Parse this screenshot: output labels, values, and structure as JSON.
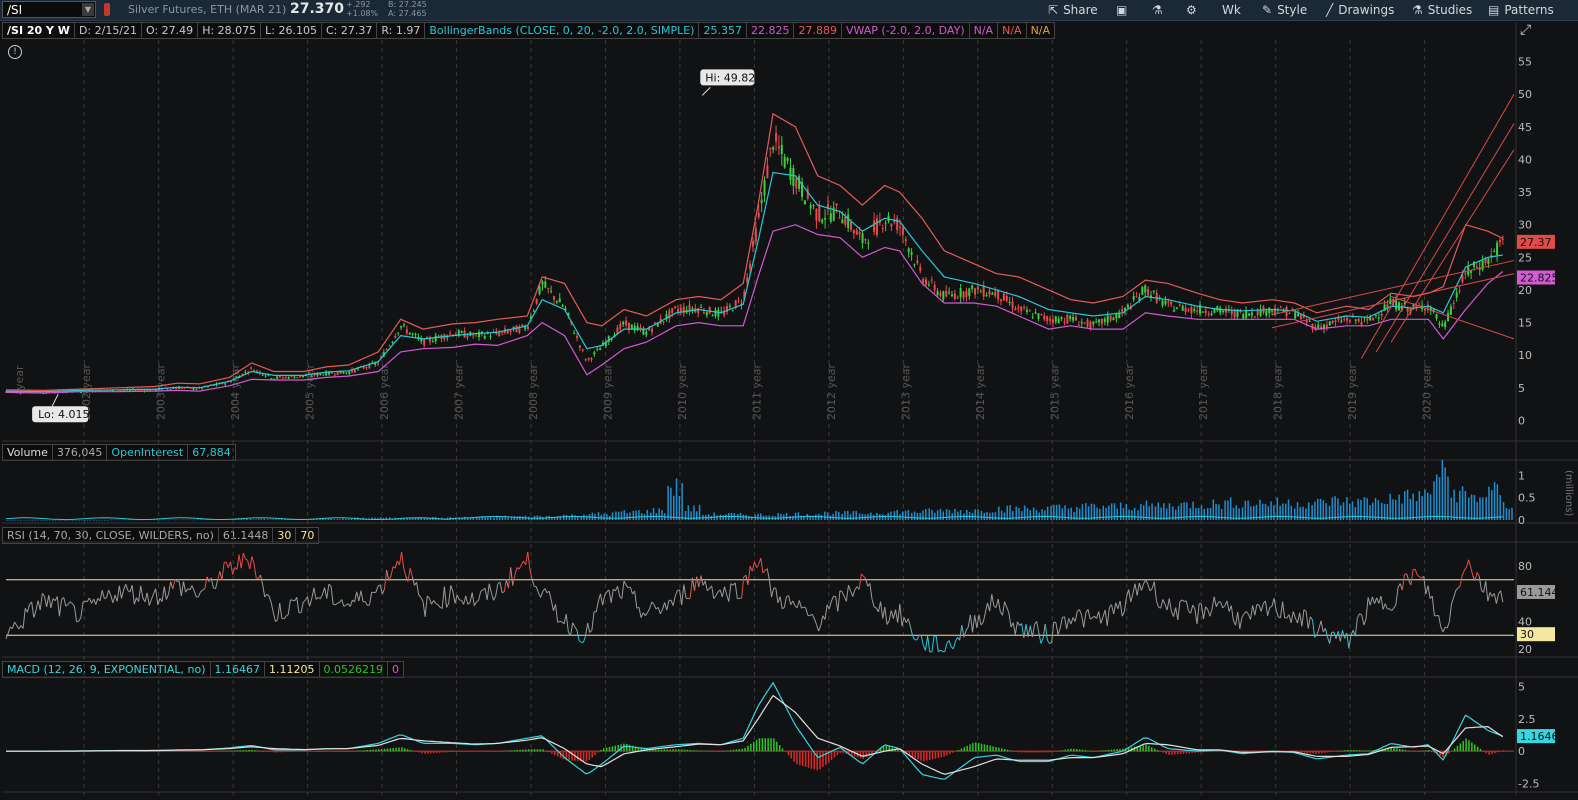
{
  "toolbar": {
    "symbol": "/SI",
    "description": "Silver Futures, ETH (MAR 21)",
    "last": "27.370",
    "change": "+.292",
    "change_pct": "+1.08%",
    "bid": "B: 27.245",
    "ask": "A: 27.465",
    "share_label": "Share",
    "aggregation_label": "Wk",
    "style_label": "Style",
    "drawings_label": "Drawings",
    "studies_label": "Studies",
    "patterns_label": "Patterns"
  },
  "price_header": {
    "tf": "/SI 20 Y W",
    "date": "D: 2/15/21",
    "open": "O: 27.49",
    "high": "H: 28.075",
    "low": "L: 26.105",
    "close": "C: 27.37",
    "range": "R: 1.97",
    "bb_label": "BollingerBands (CLOSE, 0, 20, -2.0, 2.0, SIMPLE)",
    "bb_mid": "25.357",
    "bb_low": "22.825",
    "bb_up": "27.889",
    "vwap_label": "VWAP (-2.0, 2.0, DAY)",
    "vwap_1": "N/A",
    "vwap_2": "N/A",
    "vwap_3": "N/A"
  },
  "volume_header": {
    "label": "Volume",
    "value": "376,045",
    "oi_label": "OpenInterest",
    "oi_value": "67,884"
  },
  "rsi_header": {
    "label": "RSI (14, 70, 30, CLOSE, WILDERS, no)",
    "value": "61.1448",
    "os": "30",
    "ob": "70"
  },
  "macd_header": {
    "label": "MACD (12, 26, 9, EXPONENTIAL, no)",
    "value": "1.16467",
    "avg": "1.11205",
    "diff": "0.0526219",
    "zero": "0"
  },
  "annotations": {
    "hi": "Hi: 49.82",
    "lo": "Lo: 4.015",
    "last_price": "27.37",
    "bb_lower_tag": "22.825",
    "rsi_tag": "61.1448",
    "rsi_os_tag": "30",
    "macd_tag": "1.16467"
  },
  "volume_unit": "(millions)",
  "colors": {
    "bg": "#111214",
    "up": "#3ecf3e",
    "down": "#e84a4a",
    "bb_upper": "#e65a5a",
    "bb_mid": "#28c8d8",
    "bb_lower": "#d25ad2",
    "volume": "#1f8fcf",
    "rsi": "#9a9a9a",
    "macd": "#38d6e0",
    "macd_avg": "#e0e0e0",
    "hist_up": "#28c828",
    "hist_down": "#e02828",
    "band_line": "#f5e6a0"
  },
  "chart_data": [
    {
      "type": "line",
      "title": "/SI 20 Y W",
      "x_label_format": "year",
      "x_years": [
        "2002 year",
        "2003 year",
        "2004 year",
        "2005 year",
        "2006 year",
        "2007 year",
        "2008 year",
        "2009 year",
        "2010 year",
        "2011 year",
        "2012 year",
        "2013 year",
        "2014 year",
        "2015 year",
        "2016 year",
        "2017 year",
        "2018 year",
        "2019 year",
        "2020 year"
      ],
      "first_tick_label": "year",
      "ylim": [
        0,
        55
      ],
      "y_ticks": [
        0,
        5,
        10,
        15,
        20,
        25,
        30,
        35,
        40,
        45,
        50,
        55
      ],
      "series": [
        {
          "name": "close",
          "x": [
            2001.0,
            2001.5,
            2002.0,
            2002.5,
            2003.0,
            2003.3,
            2003.6,
            2004.0,
            2004.3,
            2004.6,
            2005.0,
            2005.3,
            2005.6,
            2006.0,
            2006.3,
            2006.6,
            2007.0,
            2007.3,
            2007.6,
            2008.0,
            2008.2,
            2008.5,
            2008.8,
            2009.0,
            2009.3,
            2009.6,
            2010.0,
            2010.3,
            2010.6,
            2010.9,
            2011.1,
            2011.3,
            2011.6,
            2011.9,
            2012.2,
            2012.5,
            2012.8,
            2013.0,
            2013.3,
            2013.6,
            2014.0,
            2014.3,
            2014.6,
            2015.0,
            2015.3,
            2015.6,
            2016.0,
            2016.3,
            2016.6,
            2017.0,
            2017.3,
            2017.6,
            2018.0,
            2018.3,
            2018.6,
            2019.0,
            2019.3,
            2019.6,
            2019.9,
            2020.1,
            2020.3,
            2020.6,
            2020.9,
            2021.1
          ],
          "values": [
            4.4,
            4.3,
            4.5,
            4.6,
            4.7,
            5.0,
            4.9,
            5.9,
            7.9,
            6.5,
            6.8,
            7.2,
            7.4,
            8.8,
            14.5,
            12.0,
            13.4,
            13.0,
            13.3,
            14.3,
            20.9,
            17.3,
            9.0,
            11.3,
            14.8,
            13.5,
            17.0,
            17.2,
            16.2,
            18.6,
            30.5,
            43.0,
            37.0,
            31.5,
            32.0,
            27.5,
            31.0,
            30.0,
            22.0,
            19.0,
            20.0,
            19.5,
            17.0,
            15.5,
            15.6,
            14.5,
            16.5,
            20.2,
            17.5,
            17.0,
            16.8,
            16.3,
            17.0,
            16.5,
            14.2,
            15.5,
            15.2,
            18.0,
            17.0,
            17.8,
            14.0,
            22.5,
            24.5,
            27.37
          ]
        },
        {
          "name": "bb_upper",
          "values": [
            4.7,
            4.6,
            4.8,
            5.0,
            5.2,
            5.7,
            5.6,
            6.6,
            8.8,
            7.5,
            7.5,
            8.2,
            8.5,
            10.5,
            15.5,
            14.0,
            14.8,
            15.0,
            15.5,
            16.0,
            22.0,
            21.0,
            15.0,
            14.5,
            17.0,
            16.0,
            18.5,
            19.0,
            18.5,
            21.0,
            33.0,
            47.0,
            45.0,
            37.5,
            36.0,
            33.0,
            36.0,
            35.0,
            31.0,
            26.0,
            24.0,
            22.5,
            22.0,
            20.0,
            18.5,
            18.0,
            19.0,
            21.5,
            21.0,
            19.5,
            18.5,
            18.0,
            18.5,
            18.0,
            16.5,
            17.5,
            17.0,
            19.5,
            19.0,
            19.5,
            20.5,
            30.0,
            29.0,
            27.9
          ]
        },
        {
          "name": "bb_mid",
          "values": [
            4.5,
            4.4,
            4.6,
            4.7,
            4.8,
            5.1,
            5.0,
            6.0,
            7.5,
            6.9,
            6.9,
            7.4,
            7.6,
            9.0,
            13.0,
            12.5,
            13.0,
            13.3,
            13.5,
            14.5,
            18.5,
            17.0,
            11.0,
            11.5,
            14.0,
            14.0,
            16.5,
            17.0,
            16.5,
            17.8,
            27.5,
            38.0,
            37.5,
            33.0,
            32.0,
            29.0,
            31.0,
            30.5,
            26.0,
            22.0,
            21.0,
            20.0,
            19.0,
            17.0,
            16.5,
            16.0,
            16.5,
            19.0,
            18.5,
            17.5,
            17.0,
            16.8,
            17.0,
            16.8,
            15.2,
            16.0,
            15.8,
            17.5,
            17.2,
            17.5,
            16.5,
            23.5,
            25.0,
            25.36
          ]
        },
        {
          "name": "bb_lower",
          "values": [
            4.3,
            4.2,
            4.4,
            4.4,
            4.5,
            4.6,
            4.5,
            5.3,
            6.3,
            6.2,
            6.2,
            6.6,
            6.8,
            7.5,
            10.5,
            11.0,
            11.2,
            11.7,
            11.5,
            13.0,
            15.0,
            13.0,
            7.0,
            8.5,
            11.0,
            12.0,
            14.5,
            15.0,
            14.5,
            14.5,
            22.0,
            29.0,
            30.0,
            28.5,
            28.0,
            25.0,
            26.5,
            26.0,
            21.0,
            18.0,
            18.0,
            17.5,
            16.0,
            14.0,
            14.5,
            14.0,
            14.0,
            16.5,
            16.0,
            15.5,
            15.5,
            15.5,
            15.5,
            15.5,
            14.0,
            14.5,
            14.5,
            15.5,
            15.5,
            15.5,
            12.5,
            17.0,
            21.0,
            22.83
          ]
        }
      ],
      "annotations": {
        "high": 49.82,
        "low": 4.015,
        "last": 27.37
      }
    },
    {
      "type": "bar",
      "title": "Volume",
      "ylabel": "(millions)",
      "ylim": [
        0,
        1.3
      ],
      "y_ticks": [
        0,
        0.5,
        1
      ],
      "x_range": [
        2001.0,
        2021.1
      ],
      "values": [
        0.0,
        0.0,
        0.0,
        0.0,
        0.0,
        0.0,
        0.01,
        0.01,
        0.01,
        0.01,
        0.01,
        0.02,
        0.02,
        0.02,
        0.02,
        0.02,
        0.03,
        0.03,
        0.03,
        0.03,
        0.05,
        0.06,
        0.05,
        0.06,
        0.06,
        0.06,
        0.07,
        0.08,
        0.09,
        0.09,
        0.1,
        0.1,
        0.12,
        0.15,
        0.16,
        0.2,
        0.22,
        0.25,
        0.85,
        0.3,
        0.15,
        0.15,
        0.14,
        0.14,
        0.15,
        0.16,
        0.16,
        0.18,
        0.18,
        0.18,
        0.2,
        0.22,
        0.22,
        0.24,
        0.25,
        0.25,
        0.28,
        0.3,
        0.3,
        0.3,
        0.32,
        0.33,
        0.35,
        0.35,
        0.36,
        0.38,
        0.38,
        0.4,
        0.42,
        0.42,
        0.45,
        0.45,
        0.45,
        0.45,
        0.45,
        0.45,
        0.5,
        0.48,
        0.5,
        0.55,
        0.62,
        0.65,
        1.2,
        0.7,
        0.6,
        0.75,
        0.38
      ]
    },
    {
      "type": "line",
      "title": "RSI (14, 70, 30, CLOSE, WILDERS, no)",
      "ylim": [
        15,
        95
      ],
      "y_ticks": [
        20,
        40,
        80
      ],
      "x": [
        2001.0,
        2001.5,
        2002.0,
        2002.5,
        2003.0,
        2003.3,
        2003.6,
        2004.0,
        2004.3,
        2004.6,
        2005.0,
        2005.3,
        2005.6,
        2006.0,
        2006.3,
        2006.6,
        2007.0,
        2007.3,
        2007.6,
        2008.0,
        2008.2,
        2008.5,
        2008.8,
        2009.0,
        2009.3,
        2009.6,
        2010.0,
        2010.3,
        2010.6,
        2010.9,
        2011.1,
        2011.3,
        2011.6,
        2011.9,
        2012.2,
        2012.5,
        2012.8,
        2013.0,
        2013.3,
        2013.6,
        2014.0,
        2014.3,
        2014.6,
        2015.0,
        2015.3,
        2015.6,
        2016.0,
        2016.3,
        2016.6,
        2017.0,
        2017.3,
        2017.6,
        2018.0,
        2018.3,
        2018.6,
        2019.0,
        2019.3,
        2019.6,
        2019.9,
        2020.1,
        2020.3,
        2020.6,
        2020.9,
        2021.1
      ],
      "values": [
        30,
        55,
        45,
        62,
        58,
        66,
        60,
        78,
        86,
        45,
        55,
        60,
        52,
        62,
        88,
        50,
        60,
        55,
        62,
        84,
        60,
        40,
        30,
        55,
        62,
        45,
        55,
        70,
        60,
        65,
        88,
        60,
        50,
        40,
        55,
        70,
        45,
        45,
        25,
        20,
        40,
        55,
        35,
        30,
        45,
        40,
        50,
        70,
        50,
        45,
        55,
        40,
        50,
        45,
        35,
        25,
        50,
        55,
        75,
        62,
        30,
        85,
        60,
        61
      ]
    },
    {
      "type": "line",
      "title": "MACD (12, 26, 9, EXPONENTIAL, no)",
      "ylim": [
        -3,
        5.5
      ],
      "y_ticks": [
        -2.5,
        0,
        2.5,
        5
      ],
      "x": [
        2001.0,
        2001.5,
        2002.0,
        2002.5,
        2003.0,
        2003.3,
        2003.6,
        2004.0,
        2004.3,
        2004.6,
        2005.0,
        2005.3,
        2005.6,
        2006.0,
        2006.3,
        2006.6,
        2007.0,
        2007.3,
        2007.6,
        2008.0,
        2008.2,
        2008.5,
        2008.8,
        2009.0,
        2009.3,
        2009.6,
        2010.0,
        2010.3,
        2010.6,
        2010.9,
        2011.1,
        2011.3,
        2011.6,
        2011.9,
        2012.2,
        2012.5,
        2012.8,
        2013.0,
        2013.3,
        2013.6,
        2014.0,
        2014.3,
        2014.6,
        2015.0,
        2015.3,
        2015.6,
        2016.0,
        2016.3,
        2016.6,
        2017.0,
        2017.3,
        2017.6,
        2018.0,
        2018.3,
        2018.6,
        2019.0,
        2019.3,
        2019.6,
        2019.9,
        2020.1,
        2020.3,
        2020.6,
        2020.9,
        2021.1
      ],
      "series": [
        {
          "name": "MACD",
          "values": [
            0,
            0,
            0.02,
            0.05,
            0.05,
            0.1,
            0.1,
            0.25,
            0.45,
            0.1,
            0.1,
            0.2,
            0.2,
            0.6,
            1.3,
            0.6,
            0.6,
            0.5,
            0.6,
            1.0,
            1.2,
            -0.5,
            -1.8,
            -1.0,
            0.4,
            0.2,
            0.5,
            0.6,
            0.5,
            1.0,
            3.5,
            5.3,
            2.0,
            -0.5,
            0.3,
            -1.0,
            0.5,
            0.2,
            -1.8,
            -2.2,
            -0.5,
            -0.3,
            -0.8,
            -0.8,
            -0.3,
            -0.5,
            0.0,
            1.1,
            0.2,
            0.0,
            0.1,
            -0.2,
            0.0,
            -0.1,
            -0.6,
            -0.3,
            -0.2,
            0.6,
            0.3,
            0.5,
            -0.7,
            2.8,
            1.6,
            1.16
          ]
        },
        {
          "name": "Avg",
          "values": [
            0,
            0,
            0.01,
            0.04,
            0.05,
            0.08,
            0.1,
            0.2,
            0.35,
            0.2,
            0.12,
            0.18,
            0.2,
            0.45,
            1.0,
            0.8,
            0.65,
            0.55,
            0.6,
            0.85,
            1.05,
            0.2,
            -1.0,
            -1.2,
            -0.2,
            0.1,
            0.35,
            0.55,
            0.5,
            0.8,
            2.5,
            4.3,
            3.0,
            1.0,
            0.4,
            -0.4,
            0.0,
            0.2,
            -1.0,
            -1.8,
            -1.2,
            -0.6,
            -0.7,
            -0.7,
            -0.5,
            -0.5,
            -0.2,
            0.6,
            0.5,
            0.1,
            0.1,
            -0.1,
            -0.05,
            -0.05,
            -0.4,
            -0.4,
            -0.25,
            0.3,
            0.35,
            0.4,
            -0.2,
            1.8,
            1.9,
            1.11
          ]
        }
      ]
    }
  ]
}
